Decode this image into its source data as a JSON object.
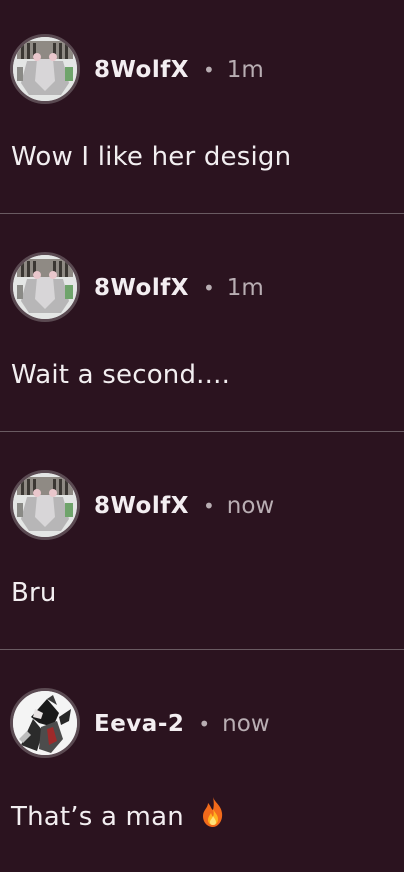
{
  "comments": [
    {
      "username": "8WolfX",
      "separator": "•",
      "time": "1m",
      "text": "Wow I like her design",
      "avatar": "robot-avatar"
    },
    {
      "username": "8WolfX",
      "separator": "•",
      "time": "1m",
      "text": "Wait a second....",
      "avatar": "robot-avatar"
    },
    {
      "username": "8WolfX",
      "separator": "•",
      "time": "now",
      "text": "Bru",
      "avatar": "robot-avatar"
    },
    {
      "username": "Eeva-2",
      "separator": "•",
      "time": "now",
      "text": "That’s a man",
      "emoji": "fire-icon",
      "avatar": "character-avatar"
    }
  ],
  "colors": {
    "background": "#2b131f",
    "divider": "#6a5b62",
    "text": "#f2eef0",
    "muted": "#b9aeb3"
  }
}
